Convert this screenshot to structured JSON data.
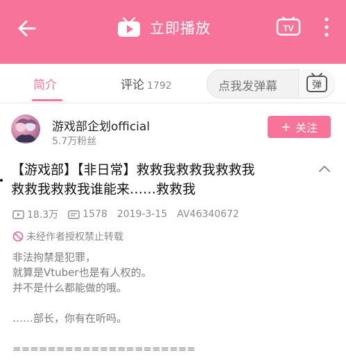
{
  "header": {
    "play_label": "立即播放",
    "tv_label": "TV",
    "accent_color": "#f7739a"
  },
  "tabs": {
    "intro_label": "简介",
    "comment_label": "评论",
    "comment_count": "1792"
  },
  "danmaku": {
    "placeholder": "点我发弹幕",
    "button_glyph": "弹"
  },
  "uploader": {
    "name": "游戏部企划official",
    "fans": "5.7万粉丝",
    "follow_label": "关注",
    "follow_plus": "+"
  },
  "video": {
    "title_line1": "【游戏部】【非日常】救救我救救我救救我",
    "title_line2": "救救我救救我谁能来……救救我",
    "views": "18.3万",
    "danmaku_count": "1578",
    "date": "2019-3-15",
    "av_id": "AV46340672",
    "copyright_notice": "未经作者授权禁止转载"
  },
  "description": {
    "lines": [
      "非法拘禁是犯罪，",
      "就算是Vtuber也是有人权的。",
      "并不是什么都能做的哦。",
      "",
      "……部长，你有在听吗。",
      "",
      "====================="
    ]
  }
}
